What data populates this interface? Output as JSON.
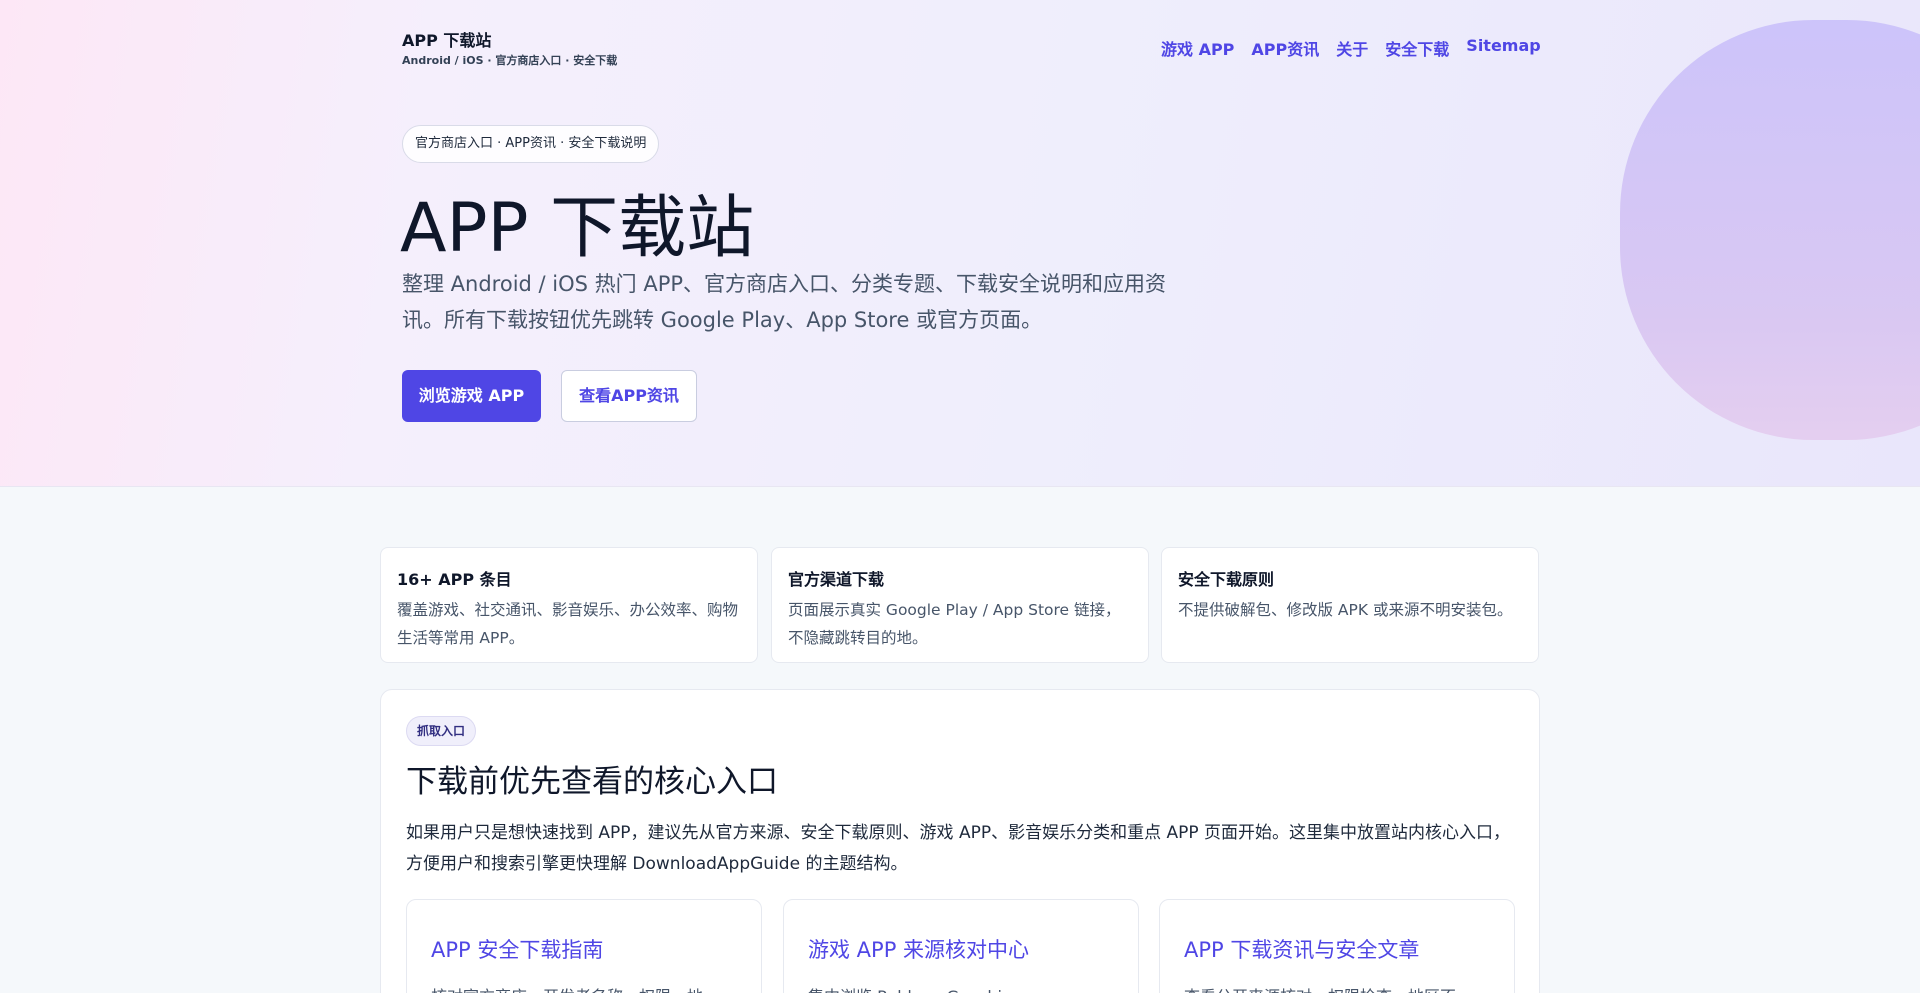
{
  "header": {
    "brand_title": "APP 下载站",
    "brand_subtitle": "Android / iOS · 官方商店入口 · 安全下载",
    "nav": [
      "游戏 APP",
      "APP资讯",
      "关于",
      "安全下载",
      "Sitemap"
    ]
  },
  "hero": {
    "pill": "官方商店入口 · APP资讯 · 安全下载说明",
    "title": "APP 下载站",
    "description": "整理 Android / iOS 热门 APP、官方商店入口、分类专题、下载安全说明和应用资讯。所有下载按钮优先跳转 Google Play、App Store 或官方页面。",
    "primary_button": "浏览游戏 APP",
    "secondary_button": "查看APP资讯"
  },
  "stats": [
    {
      "title": "16+ APP 条目",
      "text": "覆盖游戏、社交通讯、影音娱乐、办公效率、购物生活等常用 APP。"
    },
    {
      "title": "官方渠道下载",
      "text": "页面展示真实 Google Play / App Store 链接，不隐藏跳转目的地。"
    },
    {
      "title": "安全下载原则",
      "text": "不提供破解包、修改版 APK 或来源不明安装包。"
    }
  ],
  "panel": {
    "tag": "抓取入口",
    "title": "下载前优先查看的核心入口",
    "description": "如果用户只是想快速找到 APP，建议先从官方来源、安全下载原则、游戏 APP、影音娱乐分类和重点 APP 页面开始。这里集中放置站内核心入口，方便用户和搜索引擎更快理解 DownloadAppGuide 的主题结构。",
    "cards": [
      {
        "title": "APP 安全下载指南",
        "text": "核对官方商店、开发者名称、权限、地"
      },
      {
        "title": "游戏 APP 来源核对中心",
        "text": "集中浏览 Roblox、Genshin"
      },
      {
        "title": "APP 下载资讯与安全文章",
        "text": "查看公开来源核对、权限检查、地区不"
      }
    ]
  },
  "colors": {
    "accent": "#4f46e5",
    "text_dark": "#0f172a",
    "text_muted": "#475569"
  }
}
